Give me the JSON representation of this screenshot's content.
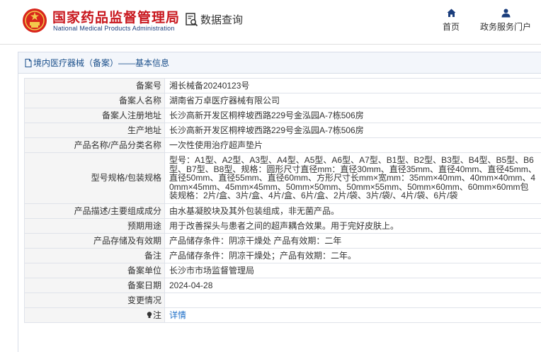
{
  "header": {
    "title_cn": "国家药品监督管理局",
    "title_en": "National Medical Products Administration",
    "query_label": "数据查询",
    "nav": [
      {
        "label": "首页",
        "icon": "home-icon"
      },
      {
        "label": "政务服务门户",
        "icon": "user-icon"
      }
    ]
  },
  "panel": {
    "heading": "境内医疗器械（备案）——基本信息"
  },
  "record": [
    {
      "label": "备案号",
      "value": "湘长械备20240123号"
    },
    {
      "label": "备案人名称",
      "value": "湖南省万卓医疗器械有限公司"
    },
    {
      "label": "备案人注册地址",
      "value": "长沙高新开发区桐梓坡西路229号金泓园A-7栋506房"
    },
    {
      "label": "生产地址",
      "value": "长沙高新开发区桐梓坡西路229号金泓园A-7栋506房"
    },
    {
      "label": "产品名称/产品分类名称",
      "value": "一次性使用治疗超声垫片"
    },
    {
      "label": "型号规格/包装规格",
      "value": "型号：A1型、A2型、A3型、A4型、A5型、A6型、A7型、B1型、B2型、B3型、B4型、B5型、B6型、B7型、B8型、规格：圆形尺寸直径mm：直径30mm、直径35mm、直径40mm、直径45mm、直径50mm、直径55mm、直径60mm、方形尺寸长mm×宽mm：35mm×40mm、40mm×40mm、40mm×45mm、45mm×45mm、50mm×50mm、50mm×55mm、50mm×60mm、60mm×60mm包装规格：2片/盒、3片/盒、4片/盒、6片/盒、2片/袋、3片/袋/、4片/袋、6片/袋"
    },
    {
      "label": "产品描述/主要组成成分",
      "value": "由水基凝胶块及其外包装组成，非无菌产品。"
    },
    {
      "label": "预期用途",
      "value": "用于改善探头与患者之间的超声耦合效果。用于完好皮肤上。"
    },
    {
      "label": "产品存储及有效期",
      "value": "产品储存条件：阴凉干燥处 产品有效期：二年"
    },
    {
      "label": "备注",
      "value": "产品储存条件：阴凉干燥处；产品有效期：二年。"
    },
    {
      "label": "备案单位",
      "value": "长沙市市场监督管理局"
    },
    {
      "label": "备案日期",
      "value": "2024-04-28"
    },
    {
      "label": "变更情况",
      "value": ""
    },
    {
      "label": "注",
      "value": "详情"
    }
  ],
  "colors": {
    "brand_red": "#c8161d",
    "brand_blue": "#1a3d7c",
    "link_blue": "#1e6fc8",
    "heading_blue": "#1a4f8b"
  }
}
